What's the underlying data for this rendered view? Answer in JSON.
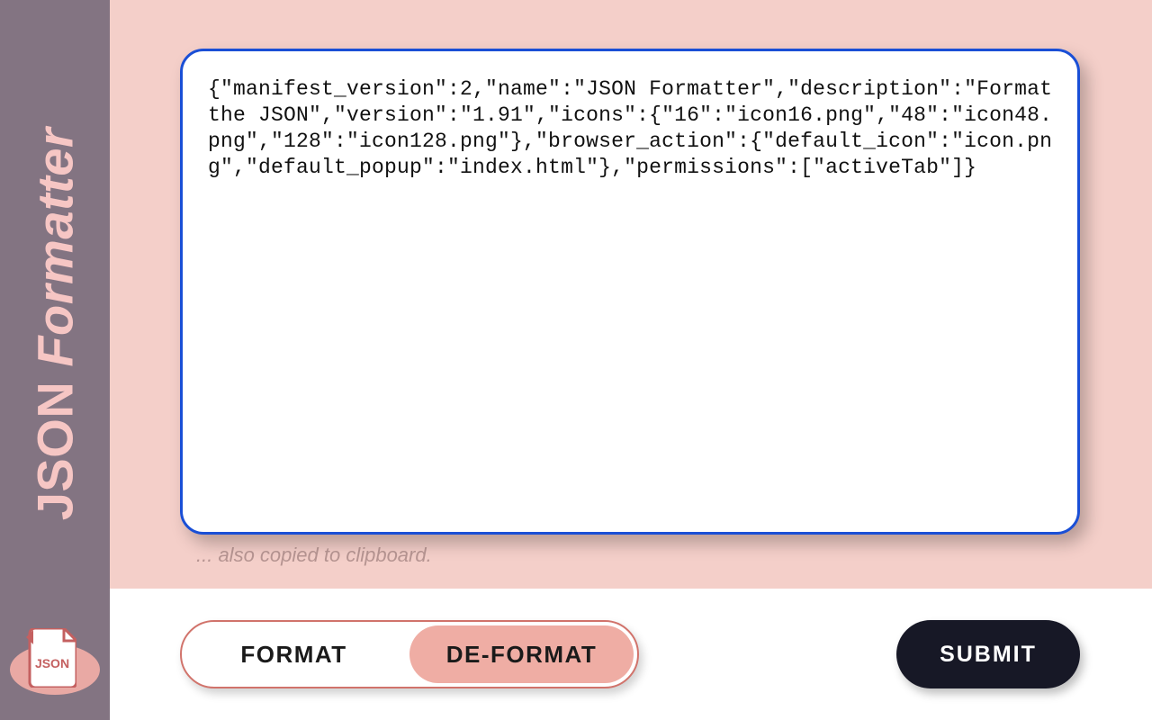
{
  "sidebar": {
    "title_word1": "JSON",
    "title_word2": "Formatter",
    "logo_label": "JSON"
  },
  "editor": {
    "json_text": "{\"manifest_version\":2,\"name\":\"JSON Formatter\",\"description\":\"Format the JSON\",\"version\":\"1.91\",\"icons\":{\"16\":\"icon16.png\",\"48\":\"icon48.png\",\"128\":\"icon128.png\"},\"browser_action\":{\"default_icon\":\"icon.png\",\"default_popup\":\"index.html\"},\"permissions\":[\"activeTab\"]}",
    "clipboard_message": "... also copied to clipboard."
  },
  "controls": {
    "format_label": "FORMAT",
    "deformat_label": "DE-FORMAT",
    "submit_label": "SUBMIT",
    "active": "deformat"
  }
}
